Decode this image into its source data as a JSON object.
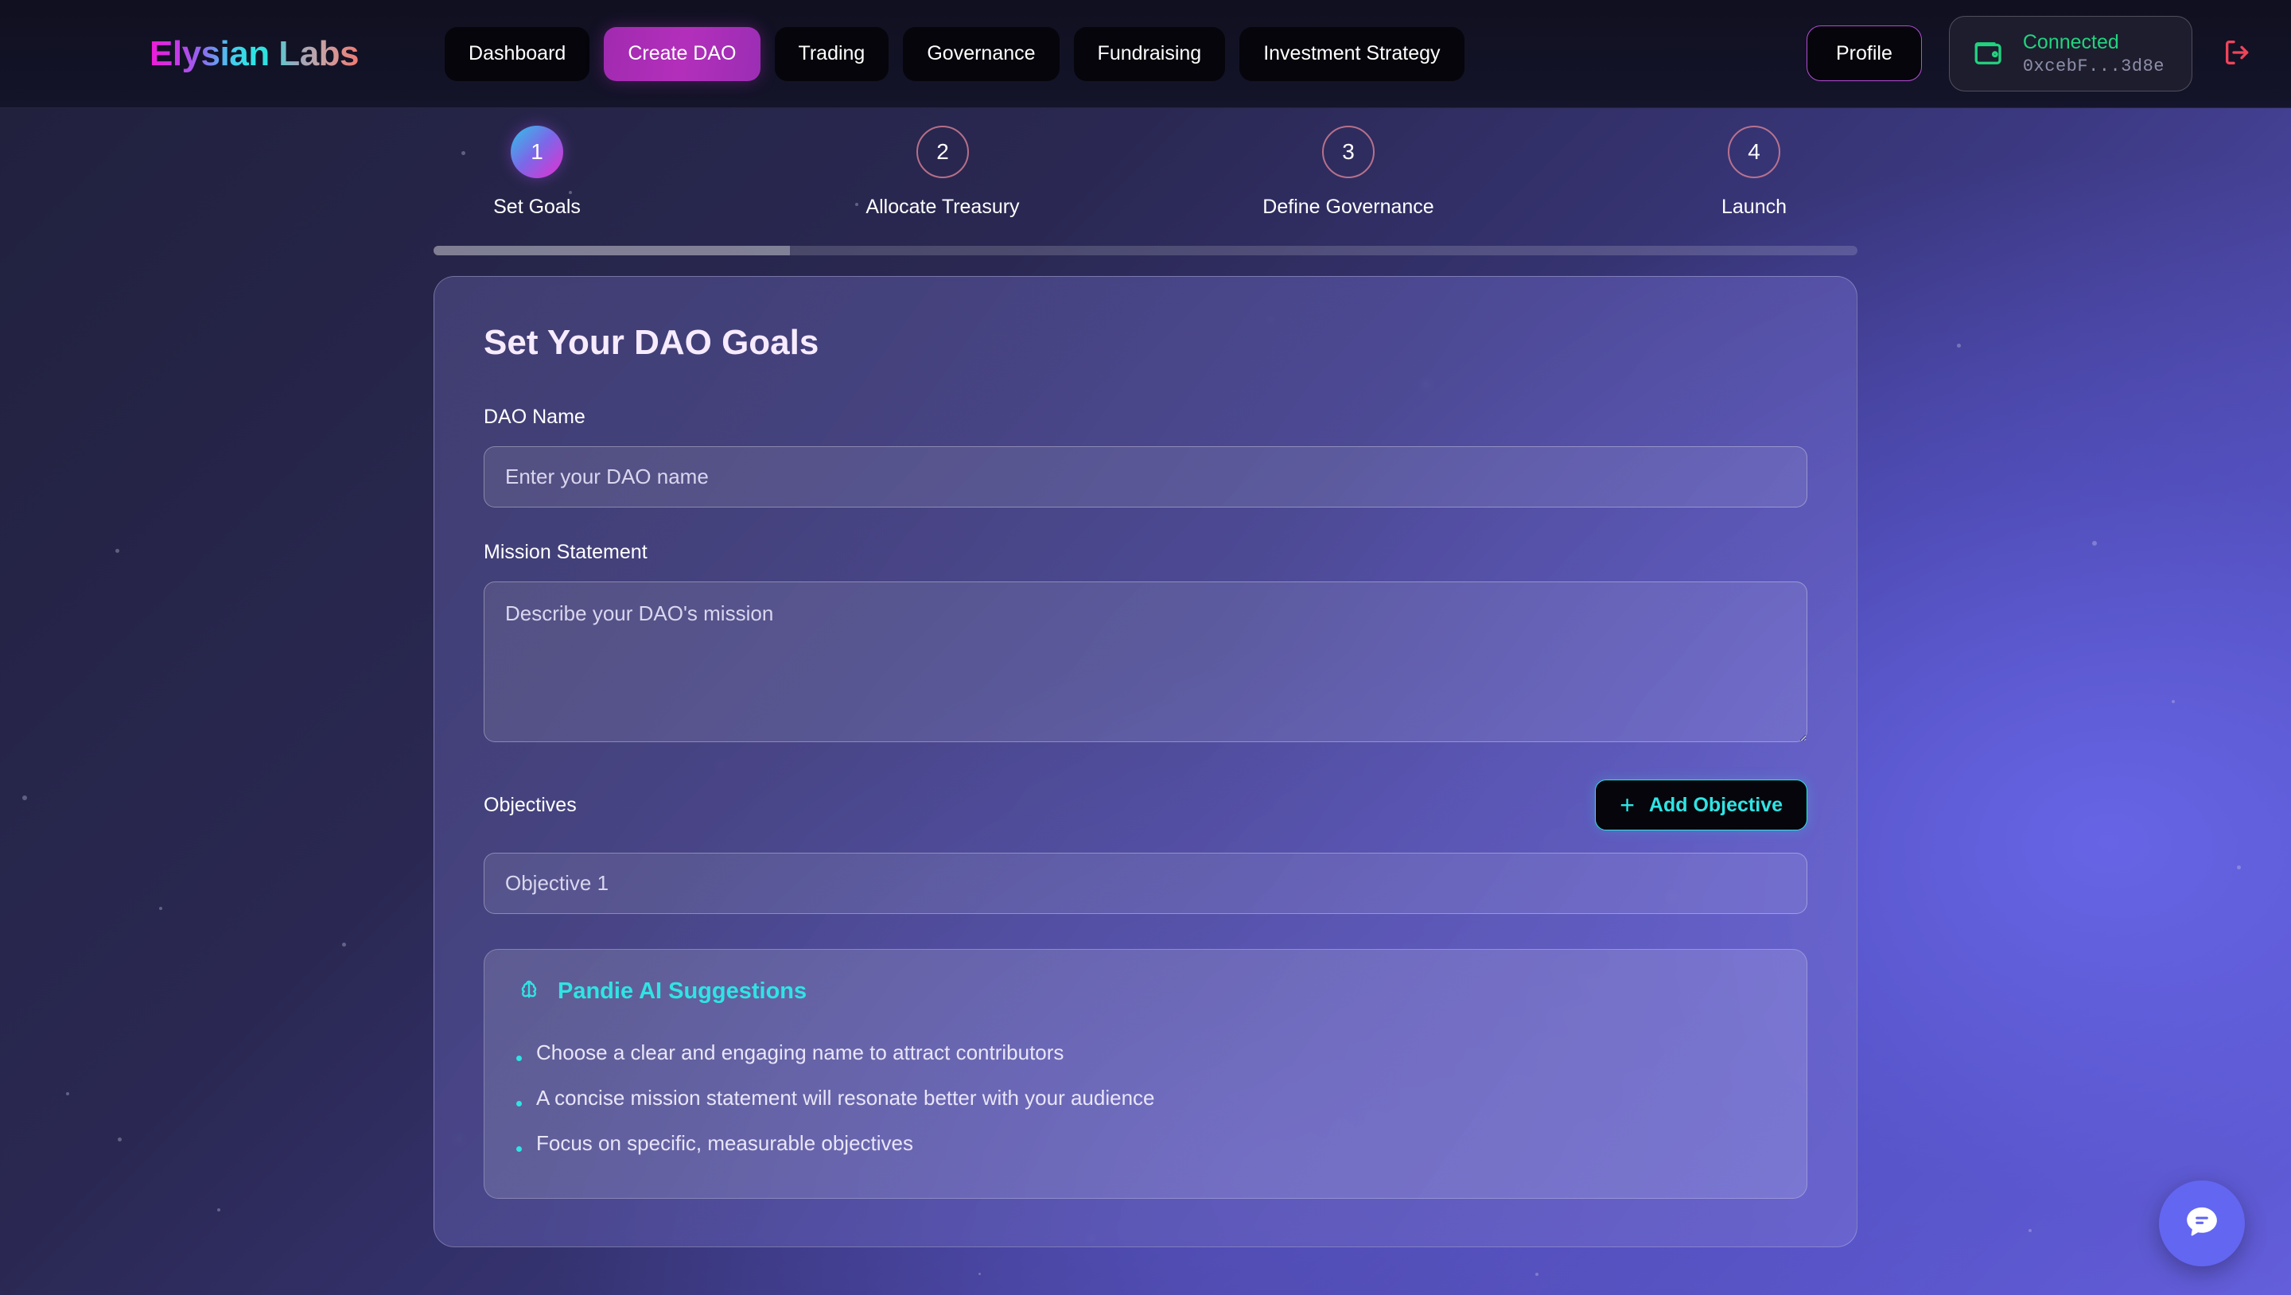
{
  "brand": {
    "name": "Elysian Labs"
  },
  "nav": {
    "items": [
      {
        "label": "Dashboard",
        "active": false
      },
      {
        "label": "Create DAO",
        "active": true
      },
      {
        "label": "Trading",
        "active": false
      },
      {
        "label": "Governance",
        "active": false
      },
      {
        "label": "Fundraising",
        "active": false
      },
      {
        "label": "Investment Strategy",
        "active": false
      }
    ],
    "profile_label": "Profile",
    "wallet": {
      "status": "Connected",
      "address": "0xcebF...3d8e",
      "icon": "wallet-icon",
      "status_color": "#22d37e"
    },
    "logout": {
      "icon": "logout-icon",
      "color": "#f0445a"
    }
  },
  "stepper": {
    "steps": [
      {
        "number": "1",
        "label": "Set Goals",
        "active": true
      },
      {
        "number": "2",
        "label": "Allocate Treasury",
        "active": false
      },
      {
        "number": "3",
        "label": "Define Governance",
        "active": false
      },
      {
        "number": "4",
        "label": "Launch",
        "active": false
      }
    ],
    "progress_percent": 25
  },
  "card": {
    "title": "Set Your DAO Goals",
    "dao_name": {
      "label": "DAO Name",
      "placeholder": "Enter your DAO name",
      "value": ""
    },
    "mission": {
      "label": "Mission Statement",
      "placeholder": "Describe your DAO's mission",
      "value": ""
    },
    "objectives": {
      "label": "Objectives",
      "add_button": "Add Objective",
      "add_icon": "plus-icon",
      "items": [
        {
          "placeholder": "Objective 1",
          "value": ""
        }
      ]
    },
    "suggestions": {
      "icon": "brain-icon",
      "title": "Pandie AI Suggestions",
      "accent_color": "#2fe4e4",
      "items": [
        "Choose a clear and engaging name to attract contributors",
        "A concise mission statement will resonate better with your audience",
        "Focus on specific, measurable objectives"
      ]
    }
  },
  "chat_fab": {
    "icon": "chat-bubble-icon",
    "color": "#6366f1"
  }
}
